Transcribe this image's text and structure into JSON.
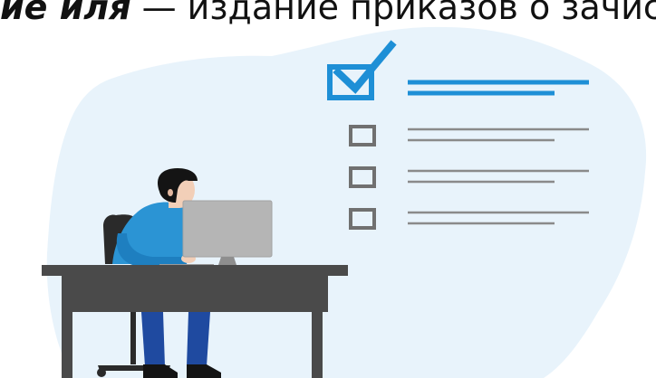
{
  "headline": {
    "bold_part": "ие иля",
    "rest_part": " — издание приказов о зачис"
  },
  "colors": {
    "blob": "#e8f3fb",
    "accent": "#1e8fd6",
    "gray_box": "#707070",
    "gray_line": "#8a8a8a",
    "desk": "#4a4a4a",
    "shirt": "#2b94d4",
    "pants": "#1f4aa0",
    "monitor": "#b5b5b5",
    "skin": "#f2cfb8",
    "hair": "#141414"
  },
  "icons": {
    "checkbox_checked": "checked-checkbox-icon",
    "checkbox_empty": "empty-checkbox-icon"
  }
}
